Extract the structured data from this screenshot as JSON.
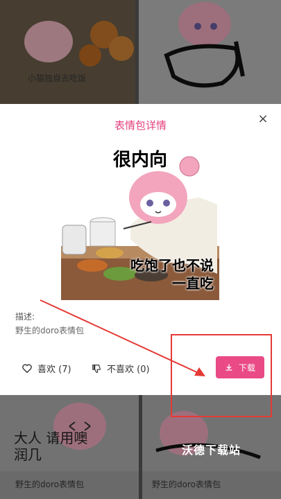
{
  "background": {
    "top_left_caption": "小猫独自去吃饭",
    "bottom_left_caption": "野生的doro表情包",
    "bottom_right_caption": "野生的doro表情包",
    "bottom_left_meme_text": "大人 请用噢润几"
  },
  "modal": {
    "title": "表情包详情",
    "close_icon": "×",
    "meme": {
      "top_text": "很内向",
      "bottom_text_line1": "吃饱了也不说",
      "bottom_text_line2": "一直吃"
    },
    "description_label": "描述:",
    "description_text": "野生的doro表情包",
    "like_label": "喜欢 (7)",
    "dislike_label": "不喜欢 (0)",
    "download_label": "下载"
  },
  "watermark": "沃德下载站",
  "colors": {
    "accent": "#e5407e",
    "download_bg": "#ea4a86",
    "annotation_red": "#e53935"
  }
}
